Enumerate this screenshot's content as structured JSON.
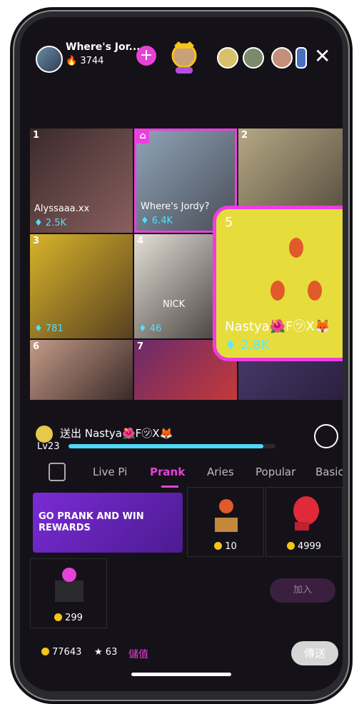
{
  "host": {
    "name": "Where's Jor...",
    "count": "3744",
    "crown_badge": "★★★"
  },
  "grid": [
    {
      "num": "1",
      "name": "Alyssaaa.xx",
      "diamonds": "2.5K"
    },
    {
      "num": "",
      "name": "Where's Jordy?",
      "diamonds": "6.4K"
    },
    {
      "num": "2",
      "name": "",
      "diamonds": ""
    },
    {
      "num": "3",
      "name": "",
      "diamonds": "781"
    },
    {
      "num": "4",
      "name": "NICK",
      "diamonds": "46"
    },
    {
      "num": "6",
      "name": "",
      "diamonds": ""
    },
    {
      "num": "7",
      "name": "",
      "diamonds": ""
    }
  ],
  "pip": {
    "num": "5",
    "name": "Nastya🌺F㋡X🦊",
    "diamonds": "2.8K"
  },
  "gift_notice": {
    "text": "送出 Nastya🌺F㋡X🦊",
    "level": "Lv23",
    "level_progress": 0.94
  },
  "tabs": [
    "Live Pi",
    "Prank",
    "Aries",
    "Popular",
    "Basic"
  ],
  "active_tab": "Prank",
  "banner": {
    "text": "GO PRANK AND WIN REWARDS"
  },
  "gifts": [
    {
      "price": "10"
    },
    {
      "price": "4999"
    },
    {
      "price": "299"
    }
  ],
  "floating_send": "加入",
  "footer": {
    "coins": "77643",
    "stars": "63",
    "topup": "儲值",
    "send": "傳送"
  }
}
